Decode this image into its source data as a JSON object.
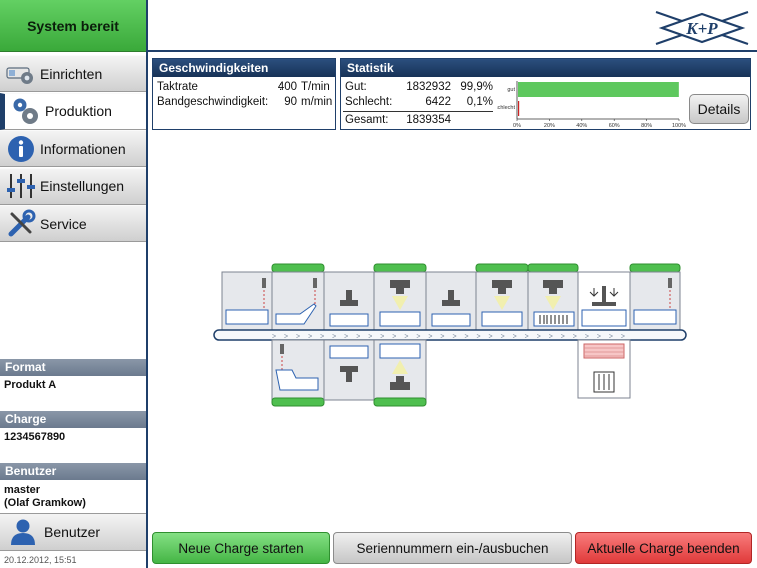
{
  "status": {
    "label": "System bereit"
  },
  "nav": {
    "items": [
      {
        "label": "Einrichten",
        "icon": "machine-gear-icon"
      },
      {
        "label": "Produktion",
        "icon": "gears-icon",
        "active": true
      },
      {
        "label": "Informationen",
        "icon": "info-icon"
      },
      {
        "label": "Einstellungen",
        "icon": "sliders-icon"
      },
      {
        "label": "Service",
        "icon": "wrench-screwdriver-icon"
      }
    ]
  },
  "info": {
    "format": {
      "label": "Format",
      "value": "Produkt A"
    },
    "charge": {
      "label": "Charge",
      "value": "1234567890"
    },
    "benutzer": {
      "label": "Benutzer",
      "value_line1": "master",
      "value_line2": "(Olaf Gramkow)"
    }
  },
  "user_button": {
    "label": "Benutzer",
    "icon": "user-icon"
  },
  "datetime": "20.12.2012, 15:51",
  "logo": {
    "text": "K+P"
  },
  "speeds": {
    "title": "Geschwindigkeiten",
    "taktrate": {
      "label": "Taktrate",
      "sep": ":",
      "value": "400",
      "unit": "T/min"
    },
    "band": {
      "label": "Bandgeschwindigkeit:",
      "value": "90",
      "unit": "m/min"
    }
  },
  "stats": {
    "title": "Statistik",
    "gut": {
      "label": "Gut:",
      "value": "1832932",
      "percent": "99,9%"
    },
    "schlecht": {
      "label": "Schlecht:",
      "value": "6422",
      "percent": "0,1%"
    },
    "gesamt": {
      "label": "Gesamt:",
      "value": "1839354"
    },
    "chart": {
      "bar_labels": [
        "gut",
        "schlecht"
      ],
      "ticks": [
        "0%",
        "20%",
        "40%",
        "60%",
        "80%",
        "100%"
      ],
      "gut_fraction": 0.999,
      "schlecht_fraction": 0.001,
      "gut_color": "#5ec85e",
      "schlecht_color": "#cc2222"
    },
    "details_label": "Details"
  },
  "actions": {
    "new_charge": "Neue Charge starten",
    "serials": "Seriennummern ein-/ausbuchen",
    "end_charge": "Aktuelle Charge beenden"
  }
}
